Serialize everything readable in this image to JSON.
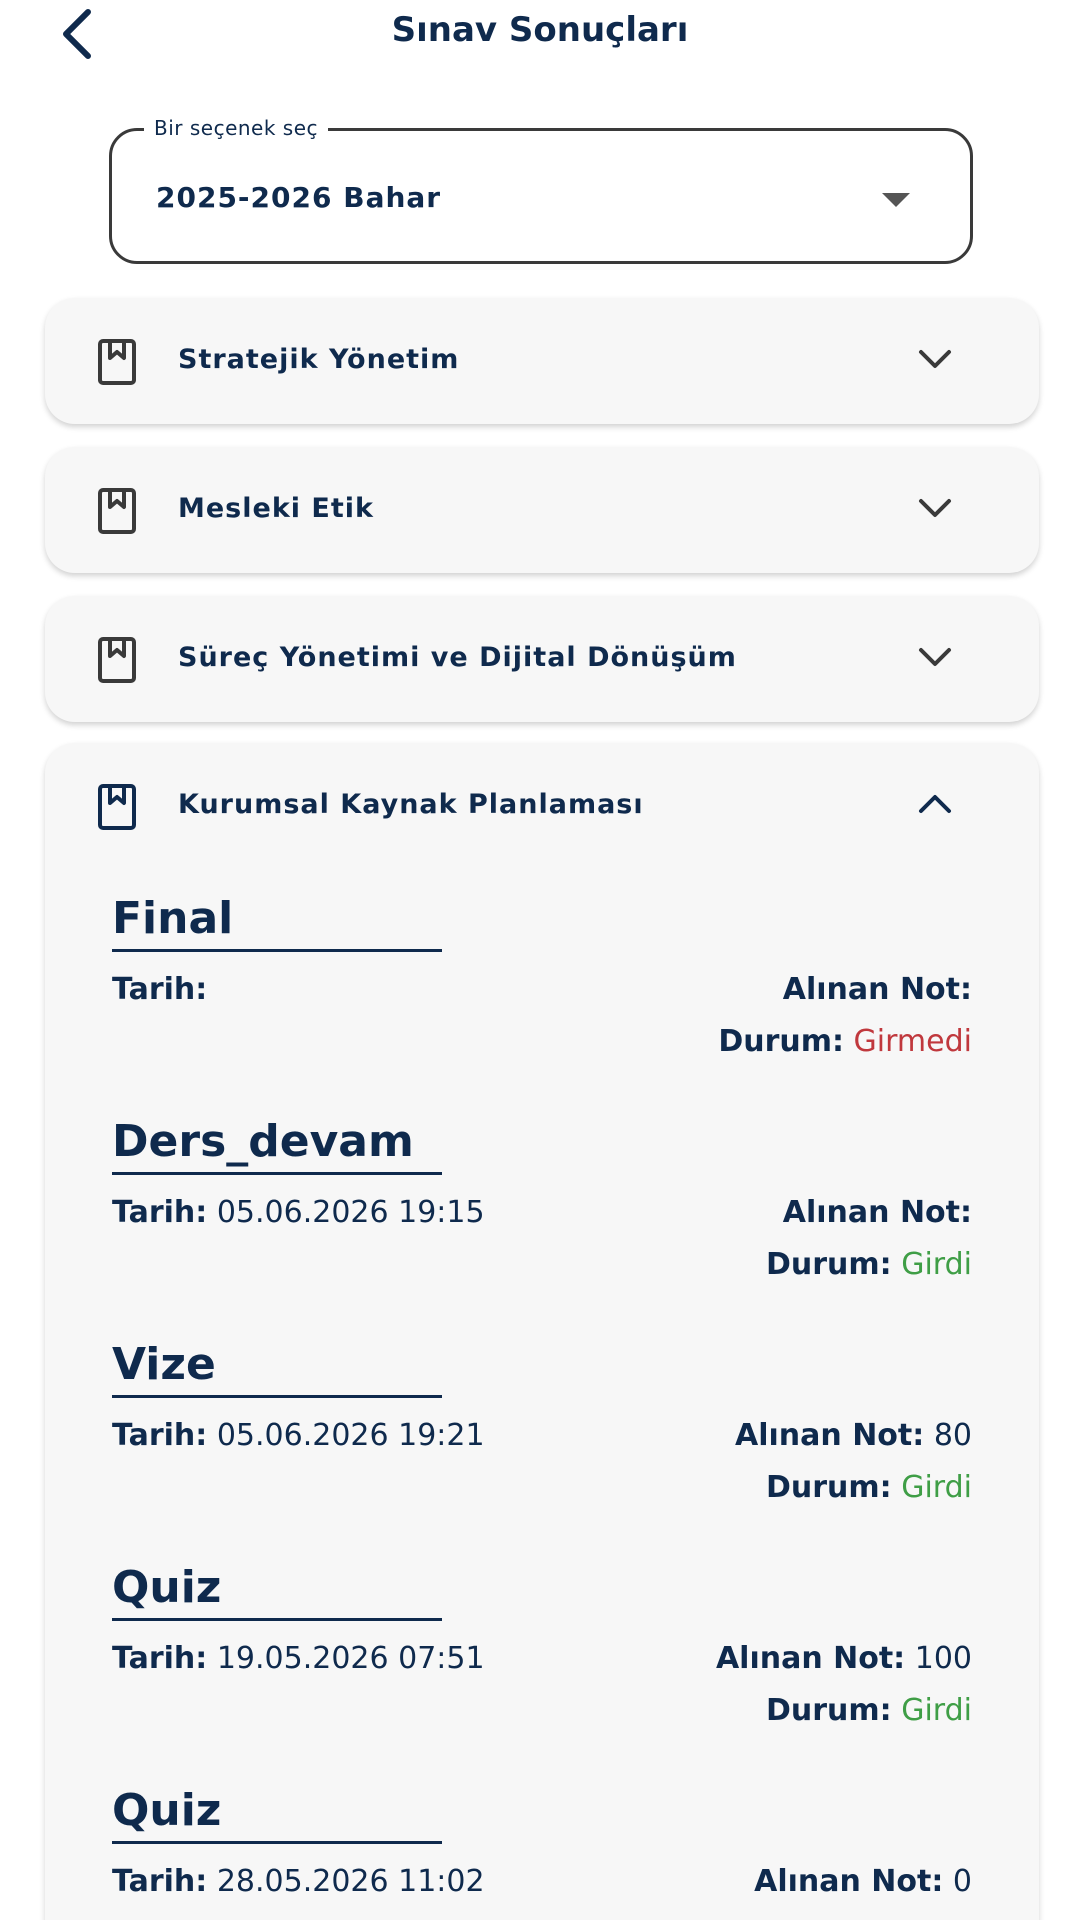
{
  "header": {
    "title": "Sınav Sonuçları"
  },
  "term_select": {
    "label": "Bir seçenek seç",
    "value": "2025-2026 Bahar"
  },
  "courses": [
    {
      "name": "Stratejik Yönetim",
      "expanded": false
    },
    {
      "name": "Mesleki Etik",
      "expanded": false
    },
    {
      "name": "Süreç Yönetimi ve Dijital Dönüşüm",
      "expanded": false
    },
    {
      "name": "Kurumsal Kaynak Planlaması",
      "expanded": true
    }
  ],
  "labels": {
    "date": "Tarih:",
    "grade": "Alınan Not:",
    "status": "Durum:"
  },
  "exams": [
    {
      "title": "Final",
      "date": "",
      "grade": "",
      "status": "Girmedi"
    },
    {
      "title": "Ders_devam",
      "date": "05.06.2026 19:15",
      "grade": "",
      "status": "Girdi"
    },
    {
      "title": "Vize",
      "date": "05.06.2026 19:21",
      "grade": "80",
      "status": "Girdi"
    },
    {
      "title": "Quiz",
      "date": "19.05.2026 07:51",
      "grade": "100",
      "status": "Girdi"
    },
    {
      "title": "Quiz",
      "date": "28.05.2026 11:02",
      "grade": "0",
      "status": ""
    }
  ],
  "colors": {
    "primary": "#0f2a4d",
    "status_not_attended": "#c0383d",
    "status_attended": "#3f9e46",
    "card_bg": "#f7f7f7"
  }
}
